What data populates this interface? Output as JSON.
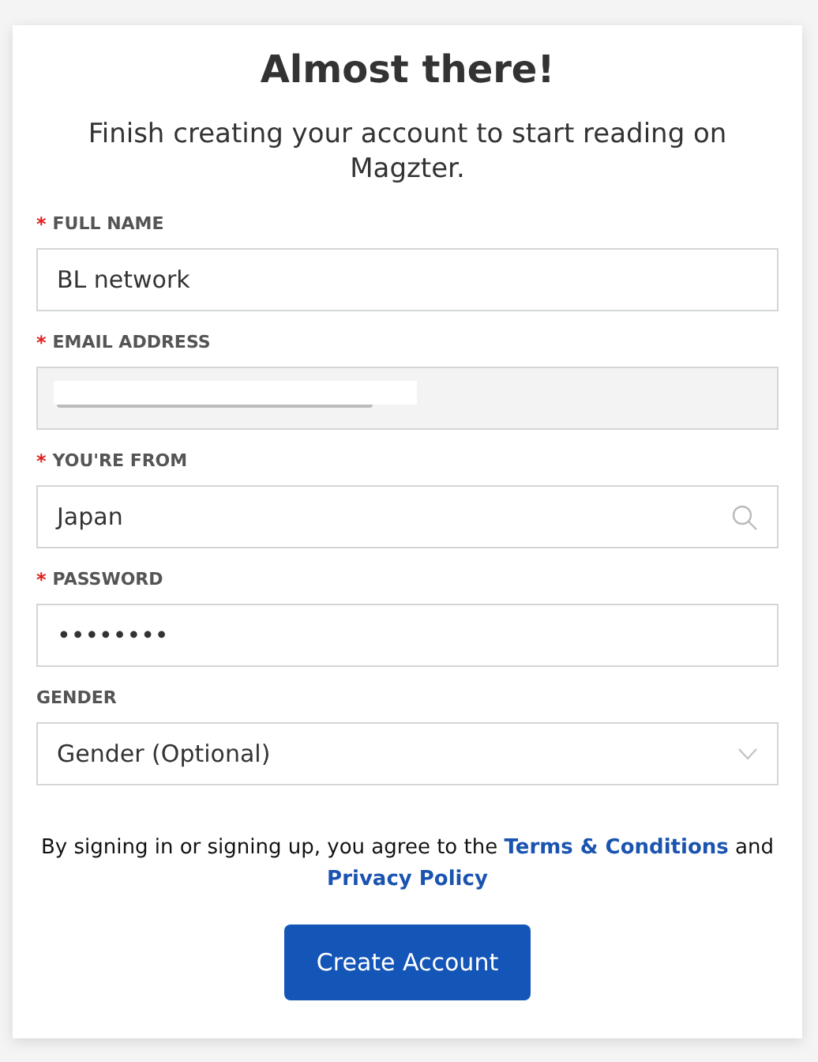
{
  "title": "Almost there!",
  "subtitle": "Finish creating your account to start reading on Magzter.",
  "fields": [
    {
      "kind": "text",
      "required_mark": "*",
      "label": "FULL NAME",
      "value": "BL network",
      "disabled": false
    },
    {
      "kind": "redacted",
      "required_mark": "*",
      "label": "EMAIL ADDRESS",
      "disabled": true
    },
    {
      "kind": "search",
      "required_mark": "*",
      "label": "YOU'RE FROM",
      "value": "Japan",
      "disabled": false
    },
    {
      "kind": "text",
      "required_mark": "*",
      "label": "PASSWORD",
      "value": "••••••••",
      "disabled": false
    },
    {
      "kind": "select",
      "label": "GENDER",
      "value": "Gender (Optional)",
      "disabled": false
    }
  ],
  "agreement": {
    "text": "By signing in or signing up, you agree to the",
    "terms_link": "Terms & Conditions",
    "joiner": "and",
    "privacy_link": "Privacy Policy"
  },
  "submit": "Create Account"
}
